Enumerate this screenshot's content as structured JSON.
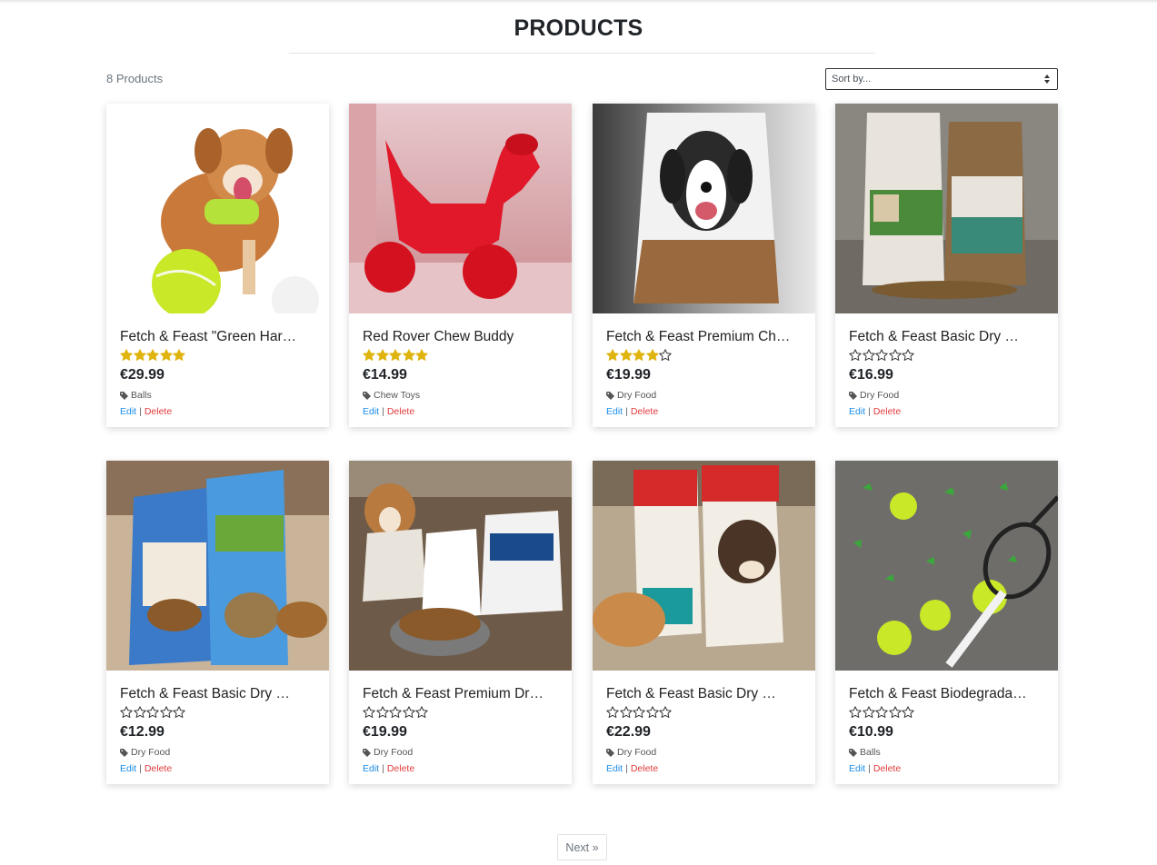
{
  "page": {
    "title": "PRODUCTS",
    "product_count": "8 Products",
    "sort_placeholder": "Sort by...",
    "pagination_next": "Next »"
  },
  "colors": {
    "star_filled": "#e0b40f",
    "edit_link": "#1a8ce8",
    "delete_link": "#e23b3b",
    "price": "#212529"
  },
  "products": [
    {
      "name": "Fetch & Feast \"Green Har…",
      "rating": 5,
      "max_rating": 5,
      "price": "€29.99",
      "category": "Balls",
      "edit_label": "Edit",
      "delete_label": "Delete",
      "image": "dog-with-green-ball"
    },
    {
      "name": "Red Rover Chew Buddy",
      "rating": 5,
      "max_rating": 5,
      "price": "€14.99",
      "category": "Chew Toys",
      "edit_label": "Edit",
      "delete_label": "Delete",
      "image": "red-dog-chew-toy"
    },
    {
      "name": "Fetch & Feast Premium Ch…",
      "rating": 4,
      "max_rating": 5,
      "price": "€19.99",
      "category": "Dry Food",
      "edit_label": "Edit",
      "delete_label": "Delete",
      "image": "dog-food-bag"
    },
    {
      "name": "Fetch & Feast Basic Dry …",
      "rating": 0,
      "max_rating": 5,
      "price": "€16.99",
      "category": "Dry Food",
      "edit_label": "Edit",
      "delete_label": "Delete",
      "image": "two-food-bags"
    },
    {
      "name": "Fetch & Feast Basic Dry …",
      "rating": 0,
      "max_rating": 5,
      "price": "€12.99",
      "category": "Dry Food",
      "edit_label": "Edit",
      "delete_label": "Delete",
      "image": "two-food-bags-blue"
    },
    {
      "name": "Fetch & Feast Premium Dr…",
      "rating": 0,
      "max_rating": 5,
      "price": "€19.99",
      "category": "Dry Food",
      "edit_label": "Edit",
      "delete_label": "Delete",
      "image": "dogs-with-food-bags"
    },
    {
      "name": "Fetch & Feast Basic Dry …",
      "rating": 0,
      "max_rating": 5,
      "price": "€22.99",
      "category": "Dry Food",
      "edit_label": "Edit",
      "delete_label": "Delete",
      "image": "dogs-eating-food"
    },
    {
      "name": "Fetch & Feast Biodegrada…",
      "rating": 0,
      "max_rating": 5,
      "price": "€10.99",
      "category": "Balls",
      "edit_label": "Edit",
      "delete_label": "Delete",
      "image": "tennis-balls-racket"
    }
  ]
}
